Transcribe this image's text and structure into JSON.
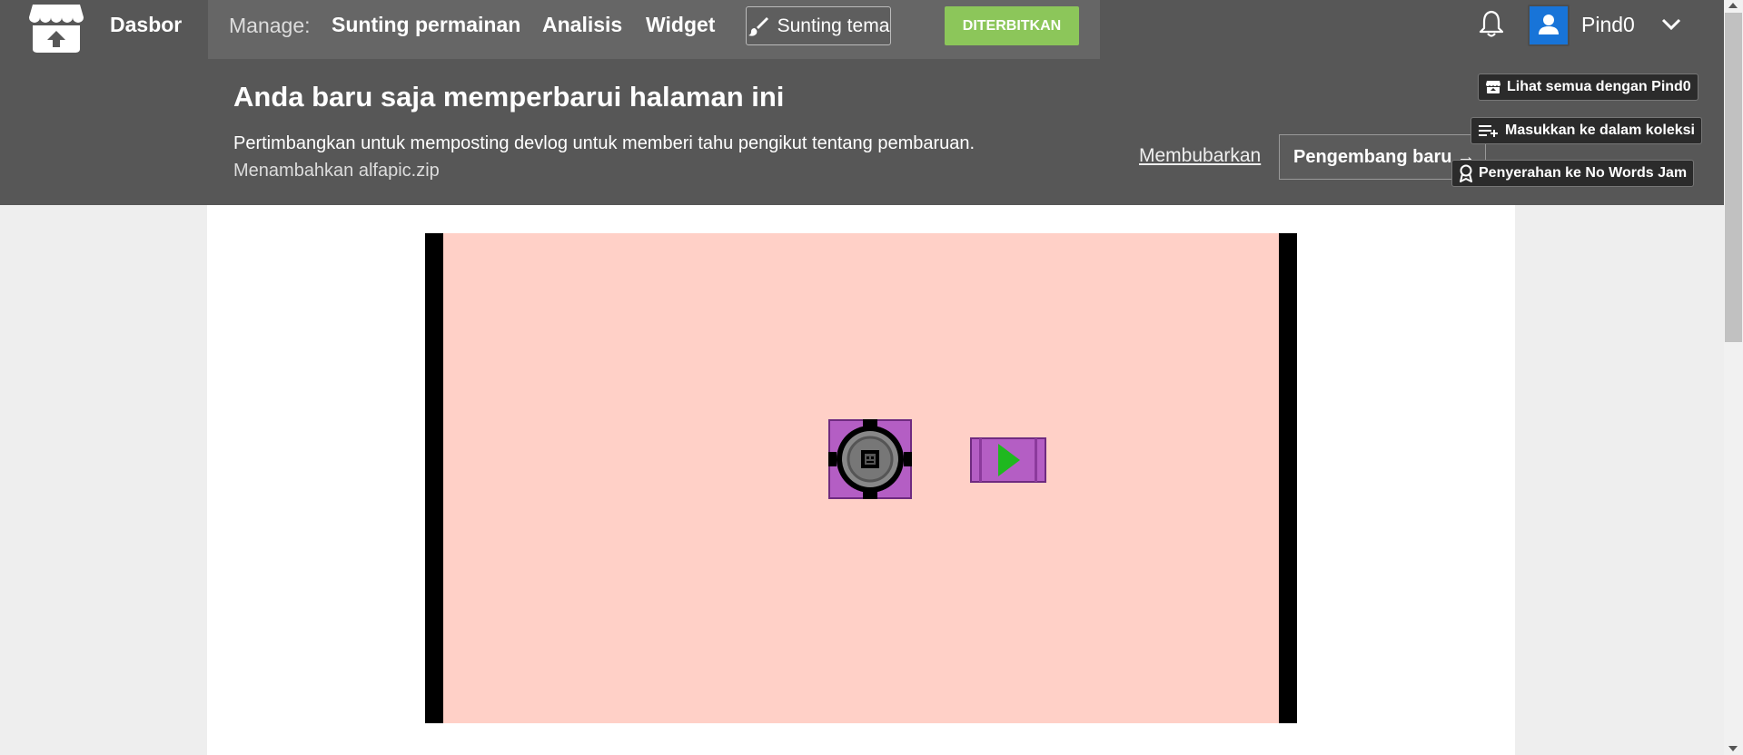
{
  "header": {
    "dashboard_label": "Dasbor",
    "manage_label": "Manage:",
    "nav": [
      {
        "label": "Sunting permainan"
      },
      {
        "label": "Analisis"
      },
      {
        "label": "Widget"
      }
    ],
    "edit_theme_label": "Sunting tema",
    "status_label": "DITERBITKAN",
    "username": "Pind0"
  },
  "banner": {
    "title": "Anda baru saja memperbarui halaman ini",
    "message": "Pertimbangkan untuk memposting devlog untuk memberi tahu pengikut tentang pembaruan.",
    "sub_message": "Menambahkan alfapic.zip",
    "dismiss_label": "Membubarkan",
    "new_devlog_label": "Pengembang baru →"
  },
  "game_actions": [
    {
      "label": "Lihat semua dengan Pind0",
      "icon": "itch-logo-icon"
    },
    {
      "label": "Masukkan ke dalam koleksi",
      "icon": "add-to-list-icon"
    },
    {
      "label": "Penyerahan ke No Words Jam",
      "icon": "ribbon-icon"
    }
  ],
  "colors": {
    "header_bg": "#575757",
    "manage_bg": "#666666",
    "published_green": "#8cc65a",
    "avatar_blue": "#1874d8",
    "game_bg": "#ffd0c7",
    "sprite_purple": "#b45ec4",
    "play_green": "#1fb81f"
  }
}
